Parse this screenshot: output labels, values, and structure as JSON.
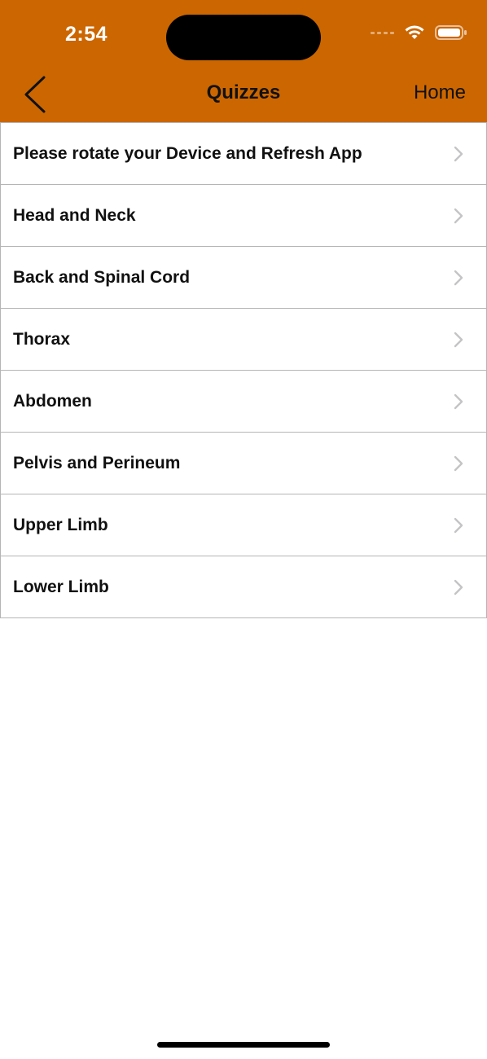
{
  "status_bar": {
    "time": "2:54"
  },
  "nav": {
    "title": "Quizzes",
    "home_label": "Home"
  },
  "list": {
    "items": [
      {
        "label": "Please rotate your Device and Refresh App"
      },
      {
        "label": "Head and Neck"
      },
      {
        "label": "Back and Spinal Cord"
      },
      {
        "label": "Thorax"
      },
      {
        "label": "Abdomen"
      },
      {
        "label": "Pelvis and Perineum"
      },
      {
        "label": "Upper Limb"
      },
      {
        "label": "Lower Limb"
      }
    ]
  },
  "icons": {
    "back": "chevron-left-icon",
    "row": "chevron-right-icon",
    "wifi": "wifi-icon",
    "battery": "battery-icon",
    "signal": "cellular-signal-icon"
  },
  "colors": {
    "accent": "#cc6600",
    "separator": "#b5b5b5",
    "chevron": "#c4c4c6"
  }
}
